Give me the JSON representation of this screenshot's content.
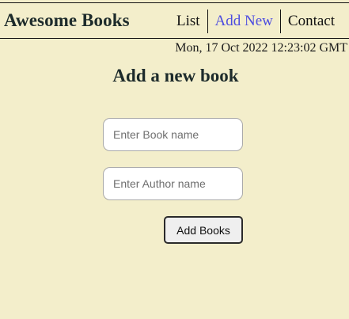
{
  "header": {
    "brand": "Awesome Books",
    "nav": {
      "list_label": "List",
      "add_new_label": "Add New",
      "contact_label": "Contact"
    },
    "active_nav": "Add New"
  },
  "datetime": "Mon, 17 Oct 2022 12:23:02 GMT",
  "form": {
    "title": "Add a new book",
    "book_name": {
      "value": "",
      "placeholder": "Enter Book name"
    },
    "author_name": {
      "value": "",
      "placeholder": "Enter Author name"
    },
    "submit_label": "Add Books"
  },
  "colors": {
    "background": "#f3eecb",
    "active_link": "#4c4ce0",
    "text": "#1d2b2b"
  }
}
